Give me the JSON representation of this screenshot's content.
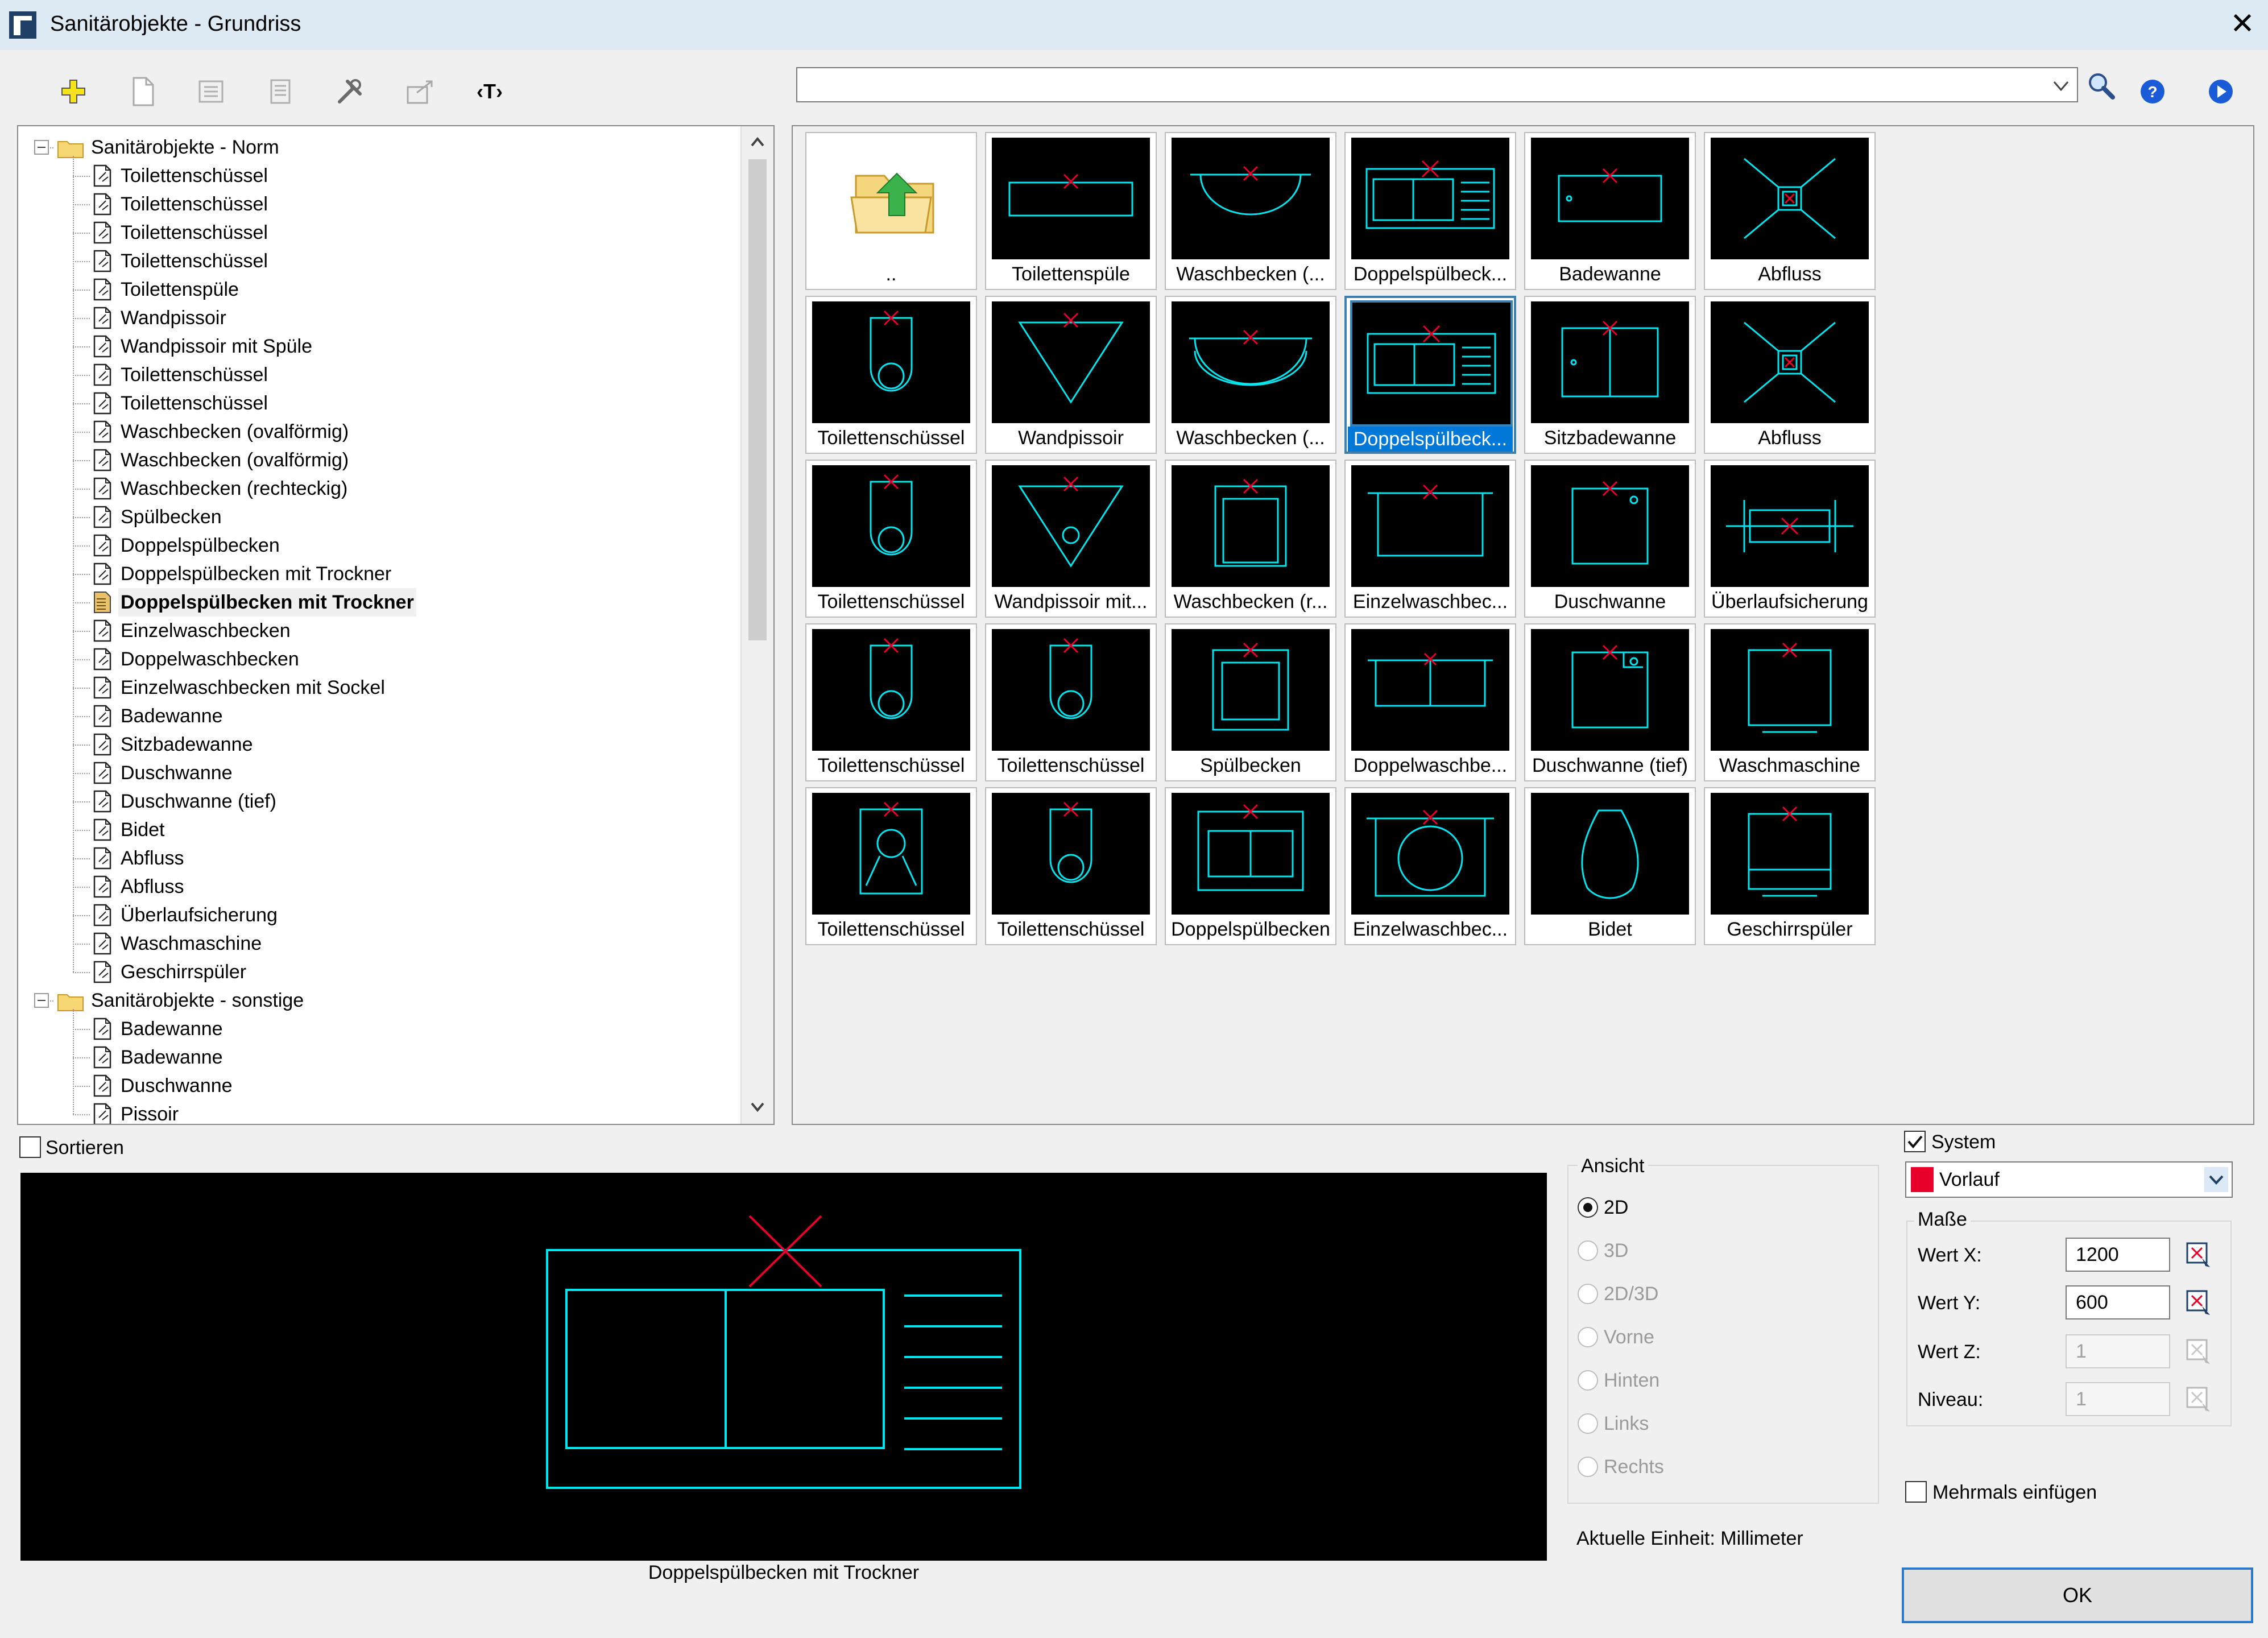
{
  "window": {
    "title": "Sanitärobjekte - Grundriss",
    "close_label": "✕"
  },
  "toolbar": {
    "text_tool_label": "‹T›"
  },
  "search": {
    "value": ""
  },
  "tree": {
    "groups": [
      {
        "label": "Sanitärobjekte - Norm",
        "expanded": true,
        "items": [
          "Toilettenschüssel",
          "Toilettenschüssel",
          "Toilettenschüssel",
          "Toilettenschüssel",
          "Toilettenspüle",
          "Wandpissoir",
          "Wandpissoir mit Spüle",
          "Toilettenschüssel",
          "Toilettenschüssel",
          "Waschbecken (ovalförmig)",
          "Waschbecken (ovalförmig)",
          "Waschbecken (rechteckig)",
          "Spülbecken",
          "Doppelspülbecken",
          "Doppelspülbecken mit Trockner",
          "Doppelspülbecken mit Trockner",
          "Einzelwaschbecken",
          "Doppelwaschbecken",
          "Einzelwaschbecken mit Sockel",
          "Badewanne",
          "Sitzbadewanne",
          "Duschwanne",
          "Duschwanne (tief)",
          "Bidet",
          "Abfluss",
          "Abfluss",
          "Überlaufsicherung",
          "Waschmaschine",
          "Geschirrspüler"
        ],
        "selected_index": 15
      },
      {
        "label": "Sanitärobjekte - sonstige",
        "expanded": true,
        "items": [
          "Badewanne",
          "Badewanne",
          "Duschwanne",
          "Pissoir"
        ]
      }
    ]
  },
  "sort": {
    "label": "Sortieren",
    "checked": false
  },
  "grid": {
    "cells": [
      {
        "caption": "..",
        "icon": "folder-up"
      },
      {
        "caption": "Toilettenspüle",
        "icon": "toilet-cistern"
      },
      {
        "caption": "Waschbecken (...",
        "icon": "washbasin-half-oval"
      },
      {
        "caption": "Doppelspülbeck...",
        "icon": "double-sink-drainer"
      },
      {
        "caption": "Badewanne",
        "icon": "bathtub"
      },
      {
        "caption": "Abfluss",
        "icon": "drain"
      },
      {
        "caption": "Toilettenschüssel",
        "icon": "toilet"
      },
      {
        "caption": "Wandpissoir",
        "icon": "urinal"
      },
      {
        "caption": "Waschbecken (...",
        "icon": "washbasin-oval"
      },
      {
        "caption": "Doppelspülbeck...",
        "icon": "double-sink-drainer",
        "selected": true
      },
      {
        "caption": "Sitzbadewanne",
        "icon": "sitz-bath"
      },
      {
        "caption": "Abfluss",
        "icon": "drain"
      },
      {
        "caption": "Toilettenschüssel",
        "icon": "toilet"
      },
      {
        "caption": "Wandpissoir mit...",
        "icon": "urinal-flush"
      },
      {
        "caption": "Waschbecken (r...",
        "icon": "washbasin-rect"
      },
      {
        "caption": "Einzelwaschbec...",
        "icon": "single-basin"
      },
      {
        "caption": "Duschwanne",
        "icon": "shower-tray"
      },
      {
        "caption": "Überlaufsicherung",
        "icon": "overflow"
      },
      {
        "caption": "Toilettenschüssel",
        "icon": "toilet"
      },
      {
        "caption": "Toilettenschüssel",
        "icon": "toilet"
      },
      {
        "caption": "Spülbecken",
        "icon": "sink"
      },
      {
        "caption": "Doppelwaschbe...",
        "icon": "double-basin"
      },
      {
        "caption": "Duschwanne (tief)",
        "icon": "shower-tray-deep"
      },
      {
        "caption": "Waschmaschine",
        "icon": "washing-machine"
      },
      {
        "caption": "Toilettenschüssel",
        "icon": "toilet-seat"
      },
      {
        "caption": "Toilettenschüssel",
        "icon": "toilet"
      },
      {
        "caption": "Doppelspülbecken",
        "icon": "double-sink"
      },
      {
        "caption": "Einzelwaschbec...",
        "icon": "basin-pedestal"
      },
      {
        "caption": "Bidet",
        "icon": "bidet"
      },
      {
        "caption": "Geschirrspüler",
        "icon": "dishwasher"
      }
    ]
  },
  "preview": {
    "caption": "Doppelspülbecken mit Trockner",
    "icon": "double-sink-drainer"
  },
  "view": {
    "title": "Ansicht",
    "options": [
      {
        "label": "2D",
        "selected": true,
        "enabled": true
      },
      {
        "label": "3D",
        "selected": false,
        "enabled": false
      },
      {
        "label": "2D/3D",
        "selected": false,
        "enabled": false
      },
      {
        "label": "Vorne",
        "selected": false,
        "enabled": false
      },
      {
        "label": "Hinten",
        "selected": false,
        "enabled": false
      },
      {
        "label": "Links",
        "selected": false,
        "enabled": false
      },
      {
        "label": "Rechts",
        "selected": false,
        "enabled": false
      }
    ]
  },
  "unit_text": "Aktuelle Einheit: Millimeter",
  "system": {
    "label": "System",
    "checked": true
  },
  "layer": {
    "value": "Vorlauf",
    "color": "#e8002a"
  },
  "dimensions": {
    "title": "Maße",
    "fields": [
      {
        "label": "Wert X:",
        "value": "1200",
        "enabled": true
      },
      {
        "label": "Wert Y:",
        "value": "600",
        "enabled": true
      },
      {
        "label": "Wert Z:",
        "value": "1",
        "enabled": false
      },
      {
        "label": "Niveau:",
        "value": "1",
        "enabled": false
      }
    ]
  },
  "multi_insert": {
    "label": "Mehrmals einfügen",
    "checked": false
  },
  "ok_button": {
    "label": "OK"
  },
  "colors": {
    "cad_line": "#00e5ee",
    "cad_marker": "#e8002a",
    "selection": "#0078d7"
  }
}
